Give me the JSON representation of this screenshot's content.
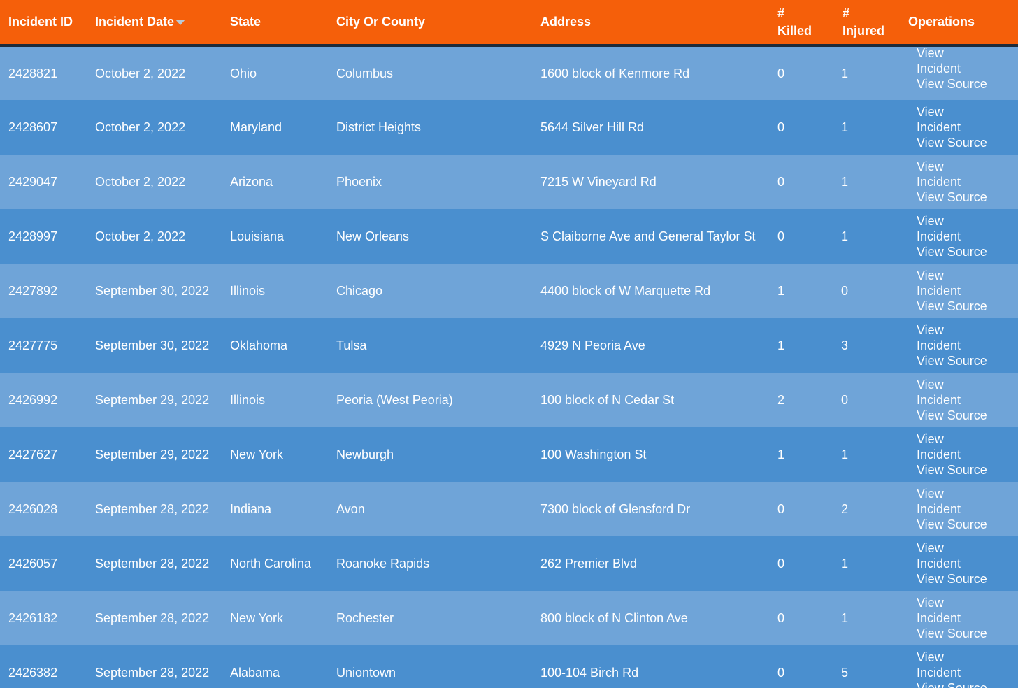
{
  "table": {
    "headers": [
      {
        "key": "id",
        "label": "Incident ID"
      },
      {
        "key": "date",
        "label": "Incident Date"
      },
      {
        "key": "state",
        "label": "State"
      },
      {
        "key": "city",
        "label": "City Or County"
      },
      {
        "key": "address",
        "label": "Address"
      },
      {
        "key": "killed",
        "label": "# Killed"
      },
      {
        "key": "injured",
        "label": "# Injured"
      },
      {
        "key": "ops",
        "label": "Operations"
      }
    ],
    "sorted_column": "Incident Date",
    "operations": {
      "view_incident_1": "View",
      "view_incident_2": "Incident",
      "view_source": "View Source"
    },
    "rows": [
      {
        "id": "2428821",
        "date": "October 2, 2022",
        "state": "Ohio",
        "city": "Columbus",
        "address": "1600 block of Kenmore Rd",
        "killed": "0",
        "injured": "1"
      },
      {
        "id": "2428607",
        "date": "October 2, 2022",
        "state": "Maryland",
        "city": "District Heights",
        "address": "5644 Silver Hill Rd",
        "killed": "0",
        "injured": "1"
      },
      {
        "id": "2429047",
        "date": "October 2, 2022",
        "state": "Arizona",
        "city": "Phoenix",
        "address": "7215 W Vineyard Rd",
        "killed": "0",
        "injured": "1"
      },
      {
        "id": "2428997",
        "date": "October 2, 2022",
        "state": "Louisiana",
        "city": "New Orleans",
        "address": "S Claiborne Ave and General Taylor St",
        "killed": "0",
        "injured": "1"
      },
      {
        "id": "2427892",
        "date": "September 30, 2022",
        "state": "Illinois",
        "city": "Chicago",
        "address": "4400 block of W Marquette Rd",
        "killed": "1",
        "injured": "0"
      },
      {
        "id": "2427775",
        "date": "September 30, 2022",
        "state": "Oklahoma",
        "city": "Tulsa",
        "address": "4929 N Peoria Ave",
        "killed": "1",
        "injured": "3"
      },
      {
        "id": "2426992",
        "date": "September 29, 2022",
        "state": "Illinois",
        "city": "Peoria (West Peoria)",
        "address": "100 block of N Cedar St",
        "killed": "2",
        "injured": "0"
      },
      {
        "id": "2427627",
        "date": "September 29, 2022",
        "state": "New York",
        "city": "Newburgh",
        "address": "100 Washington St",
        "killed": "1",
        "injured": "1"
      },
      {
        "id": "2426028",
        "date": "September 28, 2022",
        "state": "Indiana",
        "city": "Avon",
        "address": "7300 block of Glensford Dr",
        "killed": "0",
        "injured": "2"
      },
      {
        "id": "2426057",
        "date": "September 28, 2022",
        "state": "North Carolina",
        "city": "Roanoke Rapids",
        "address": "262 Premier Blvd",
        "killed": "0",
        "injured": "1"
      },
      {
        "id": "2426182",
        "date": "September 28, 2022",
        "state": "New York",
        "city": "Rochester",
        "address": "800 block of N Clinton Ave",
        "killed": "0",
        "injured": "1"
      },
      {
        "id": "2426382",
        "date": "September 28, 2022",
        "state": "Alabama",
        "city": "Uniontown",
        "address": "100-104 Birch Rd",
        "killed": "0",
        "injured": "5"
      }
    ]
  }
}
